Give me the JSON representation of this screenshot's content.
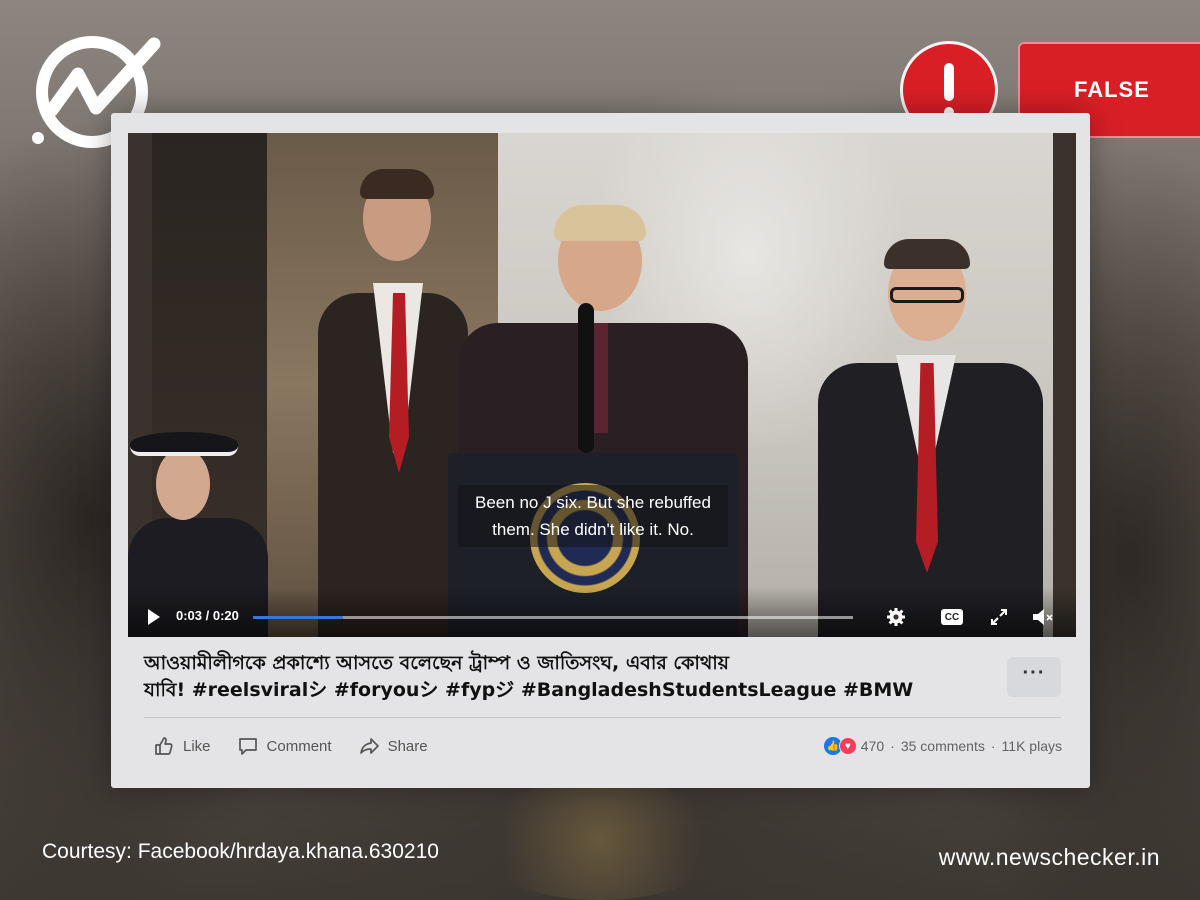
{
  "badge": {
    "verdict_label": "FALSE",
    "alert_icon": "exclamation-icon",
    "color": "#d91f26"
  },
  "logo": {
    "icon": "newschecker-logo-icon"
  },
  "video": {
    "caption_line1": "Been no J six. But she rebuffed",
    "caption_line2": "them. She didn't like it. No.",
    "time": "0:03 / 0:20",
    "progress": 0.15,
    "cc_label": "CC",
    "controls": [
      "play-icon",
      "gear-icon",
      "cc-icon",
      "expand-icon",
      "volume-muted-icon"
    ]
  },
  "post": {
    "title_line1": "আওয়ামীলীগকে প্রকাশ্যে আসতে বলেছেন ট্রাম্প ও জাতিসংঘ, এবার কোথায়",
    "title_line2": "যাবি! #reelsviralシ #foryouシ #fypジ #BangladeshStudentsLeague #BMW",
    "more_label": "···",
    "actions": {
      "like": "Like",
      "comment": "Comment",
      "share": "Share"
    },
    "stats": {
      "reactions": "470",
      "comments": "35 comments",
      "plays": "11K plays",
      "separator": "·"
    },
    "accent": "#1877f2"
  },
  "footer": {
    "courtesy": "Courtesy: Facebook/hrdaya.khana.630210",
    "site": "www.newschecker.in"
  }
}
